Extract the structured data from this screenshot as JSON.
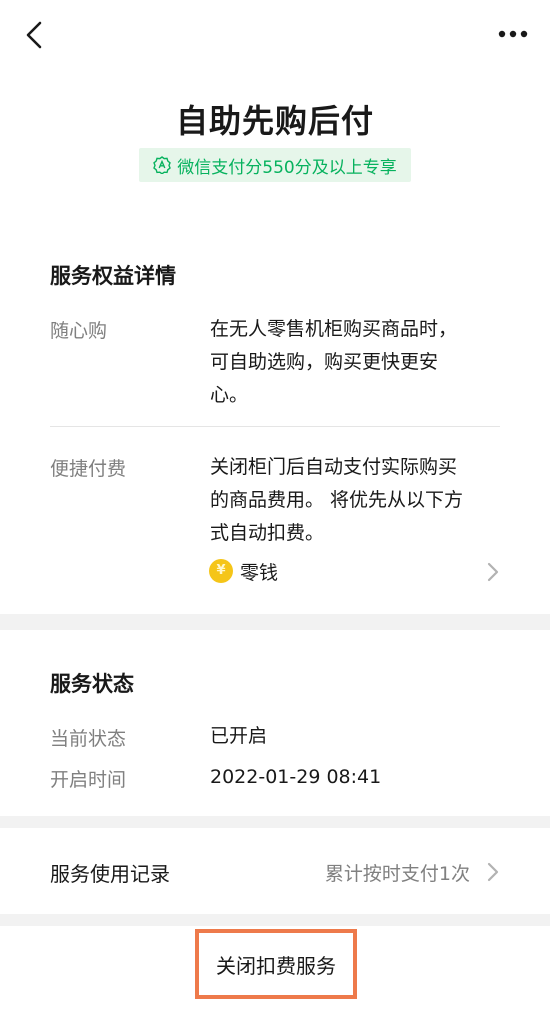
{
  "header": {
    "back_icon": "chevron-left-icon",
    "more_icon": "ellipsis-icon",
    "title": "自助先购后付",
    "badge_text": "微信支付分550分及以上专享",
    "badge_icon": "score-icon",
    "badge_color": "#07b25e"
  },
  "benefits": {
    "title": "服务权益详情",
    "items": [
      {
        "label": "随心购",
        "lines": [
          "在无人零售机柜购买商品时，",
          "可自助选购，购买更快更安",
          "心。"
        ]
      },
      {
        "label": "便捷付费",
        "lines": [
          "关闭柜门后自动支付实际购买",
          "的商品费用。 将优先从以下方",
          "式自动扣费。"
        ]
      }
    ],
    "payment_method": {
      "icon": "coin-icon",
      "label": "零钱",
      "chevron_icon": "chevron-right-icon"
    }
  },
  "status": {
    "title": "服务状态",
    "current_label": "当前状态",
    "current_value": "已开启",
    "time_label": "开启时间",
    "time_value": "2022-01-29 08:41"
  },
  "records": {
    "label": "服务使用记录",
    "value": "累计按时支付1次",
    "chevron_icon": "chevron-right-icon"
  },
  "actions": {
    "close_label": "关闭扣费服务",
    "highlight_color": "#ee7a4b"
  }
}
